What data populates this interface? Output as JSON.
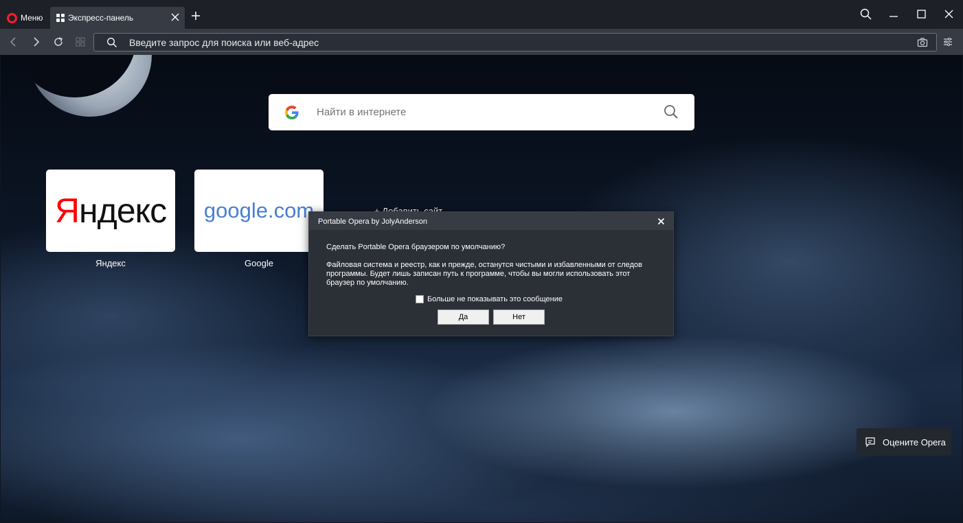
{
  "window": {
    "menu_label": "Меню",
    "tab_title": "Экспресс-панель"
  },
  "addressbar": {
    "placeholder": "Введите запрос для поиска или веб-адрес"
  },
  "speed_dial": {
    "search_placeholder": "Найти в интернете",
    "tiles": [
      {
        "logo_text_first": "Я",
        "logo_text_rest": "ндекс",
        "label": "Яндекс"
      },
      {
        "logo_text_a": "google",
        "logo_text_b": ".com",
        "label": "Google"
      }
    ],
    "add_site_label": "+ Добавить сайт"
  },
  "dialog": {
    "title": "Portable Opera by JolyAnderson",
    "question": "Сделать Portable Opera браузером по умолчанию?",
    "body_line1": "Файловая система и реестр, как и прежде, останутся чистыми и избавленными от следов",
    "body_line2": "программы. Будет лишь записан путь к программе, чтобы вы могли использовать этот",
    "body_line3": "браузер по умолчанию.",
    "checkbox_label": "Больше не показывать это сообщение",
    "yes_label": "Да",
    "no_label": "Нет"
  },
  "rate_button_label": "Оцените Opera",
  "colors": {
    "opera_red": "#ff1b2d",
    "yandex_red": "#ff0000",
    "google_blue": "#4a7fd0",
    "toolbar": "#363b44",
    "titlebar": "#1d2127"
  }
}
